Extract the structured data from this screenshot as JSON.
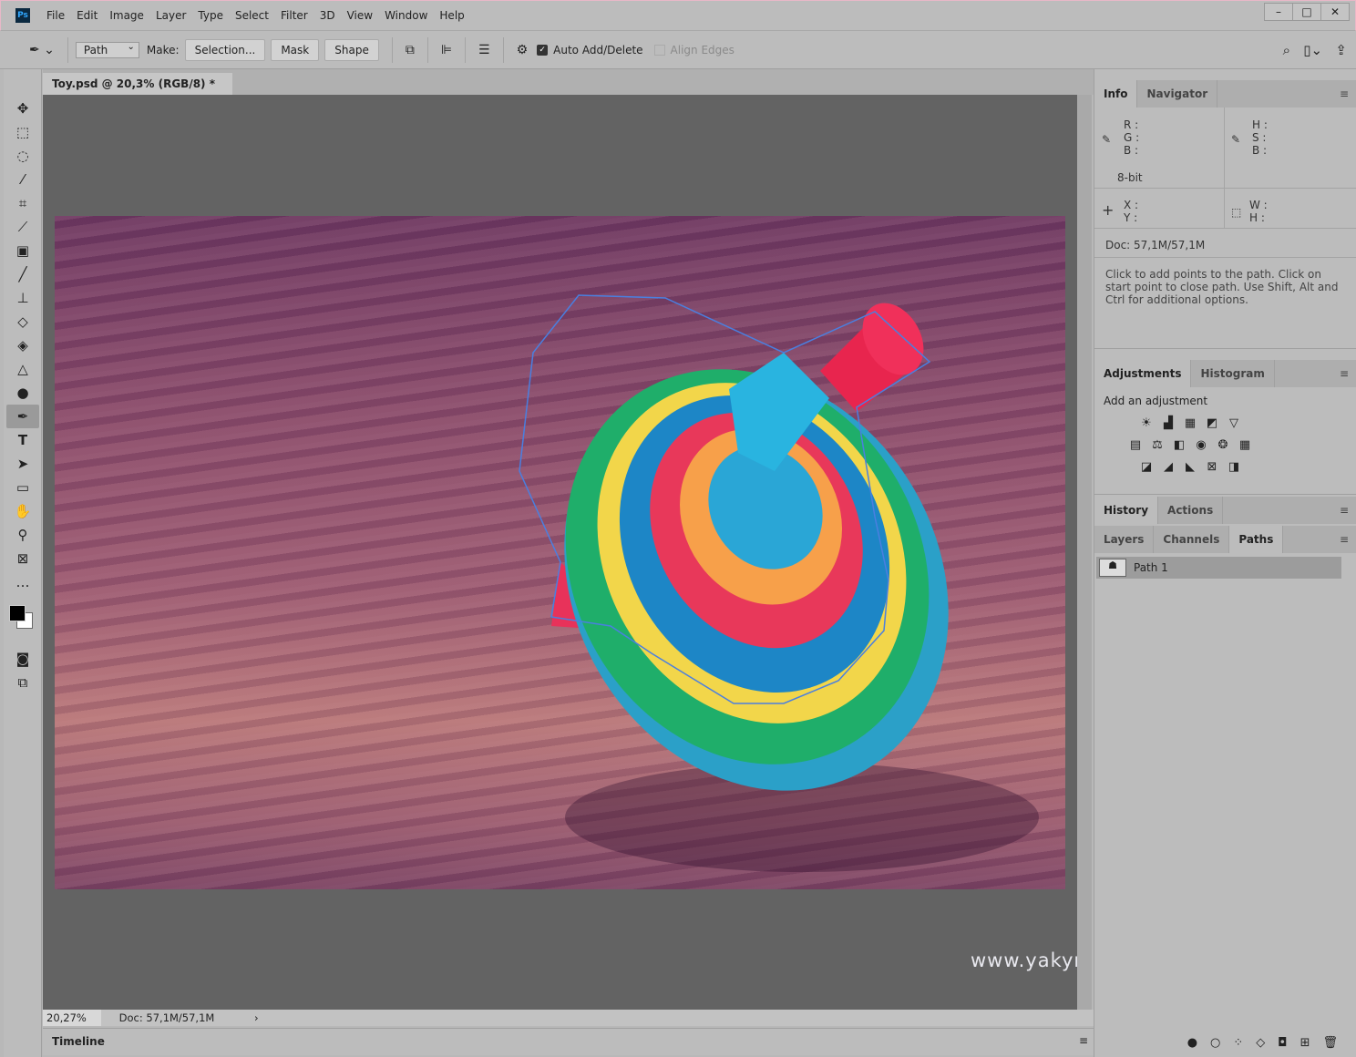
{
  "app": {
    "logo": "Ps",
    "menu": [
      "File",
      "Edit",
      "Image",
      "Layer",
      "Type",
      "Select",
      "Filter",
      "3D",
      "View",
      "Window",
      "Help"
    ],
    "window_buttons": [
      "minimize",
      "maximize",
      "close"
    ]
  },
  "options": {
    "mode": "Path",
    "make_label": "Make:",
    "selection": "Selection...",
    "mask": "Mask",
    "shape": "Shape",
    "auto_add_delete": "Auto Add/Delete",
    "auto_checked": true,
    "align_edges": "Align Edges",
    "align_checked": false
  },
  "document": {
    "tab_title": "Toy.psd @ 20,3% (RGB/8) *",
    "zoom": "20,27%",
    "doc_size": "Doc: 57,1M/57,1M",
    "watermark": "www.yakymchuk.net"
  },
  "tools": [
    "move",
    "marquee",
    "lasso",
    "magic-wand",
    "crop",
    "eyedropper",
    "healing",
    "brush",
    "stamp",
    "eraser",
    "paint-bucket",
    "blur",
    "dodge",
    "pen",
    "type",
    "path-selection",
    "rectangle",
    "hand",
    "zoom",
    "frame",
    "more"
  ],
  "info_panel": {
    "tabs": [
      "Info",
      "Navigator"
    ],
    "rgb": [
      "R :",
      "G :",
      "B :"
    ],
    "hsb": [
      "H :",
      "S :",
      "B :"
    ],
    "bitdepth": "8-bit",
    "xy": [
      "X :",
      "Y :"
    ],
    "wh": [
      "W :",
      "H :"
    ],
    "doc": "Doc: 57,1M/57,1M",
    "hint": "Click to add points to the path.  Click on start point to close path.  Use Shift, Alt and Ctrl for additional options."
  },
  "adjustments": {
    "tabs": [
      "Adjustments",
      "Histogram"
    ],
    "title": "Add an adjustment"
  },
  "history": {
    "tabs": [
      "History",
      "Actions"
    ]
  },
  "paths": {
    "tabs": [
      "Layers",
      "Channels",
      "Paths"
    ],
    "items": [
      "Path 1"
    ]
  },
  "timeline": {
    "label": "Timeline"
  },
  "colors": {
    "foreground": "#000000",
    "background": "#ffffff"
  }
}
